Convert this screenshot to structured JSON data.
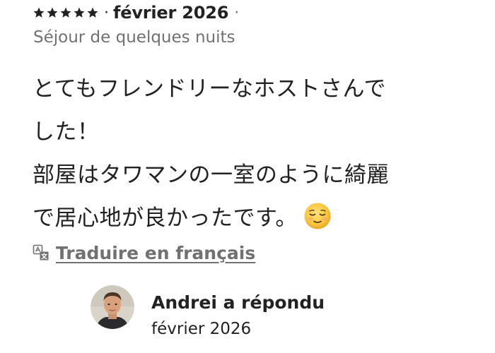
{
  "review": {
    "rating": 5,
    "rating_max": 5,
    "separator": "·",
    "date": "février 2026",
    "stay_type": "Séjour de quelques nuits",
    "body_lines": [
      "とてもフレンドリーなホストさんで",
      "した！",
      "部屋はタワマンの一室のように綺麗",
      "で居心地が良かったです。"
    ],
    "emoji": "relieved-face-emoji",
    "translate": {
      "icon": "translate-icon",
      "label": "Traduire en français"
    }
  },
  "host_response": {
    "avatar": "host-avatar",
    "title": "Andrei a répondu",
    "date": "février 2026"
  },
  "colors": {
    "text_primary": "#222222",
    "text_secondary": "#717171",
    "star": "#222222"
  }
}
